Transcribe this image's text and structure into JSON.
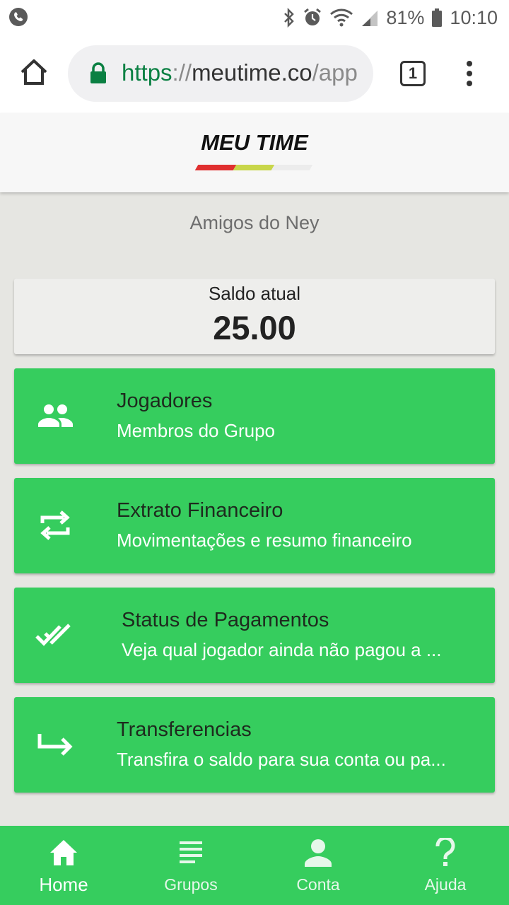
{
  "status_bar": {
    "battery": "81%",
    "time": "10:10",
    "icons": [
      "phone-call-icon",
      "bluetooth-icon",
      "alarm-icon",
      "wifi-icon",
      "signal-icon",
      "battery-icon"
    ]
  },
  "browser": {
    "url_scheme": "https",
    "url_separator": "://",
    "url_host": "meutime.co",
    "url_rest": "/app",
    "tab_count": "1"
  },
  "app": {
    "logo": "MEU TIME",
    "group_name": "Amigos do Ney"
  },
  "balance": {
    "label": "Saldo atual",
    "value": "25.00"
  },
  "menu": [
    {
      "title": "Jogadores",
      "subtitle": "Membros do Grupo",
      "icon": "group-icon"
    },
    {
      "title": "Extrato Financeiro",
      "subtitle": "Movimentações e resumo financeiro",
      "icon": "swap-icon"
    },
    {
      "title": "Status de Pagamentos",
      "subtitle": "Veja qual jogador ainda não pagou a ...",
      "icon": "double-check-icon"
    },
    {
      "title": "Transferencias",
      "subtitle": "Transfira o saldo para sua conta ou pa...",
      "icon": "redirect-arrow-icon"
    }
  ],
  "bottom_nav": [
    {
      "label": "Home",
      "icon": "home-icon",
      "active": true
    },
    {
      "label": "Grupos",
      "icon": "list-icon",
      "active": false
    },
    {
      "label": "Conta",
      "icon": "person-icon",
      "active": false
    },
    {
      "label": "Ajuda",
      "icon": "help-icon",
      "active": false
    }
  ],
  "colors": {
    "primary_green": "#36cd5e",
    "background": "#e6e6e2",
    "secure_green": "#0b8043",
    "logo_red": "#e02f2f",
    "logo_lime": "#c8d64a"
  }
}
